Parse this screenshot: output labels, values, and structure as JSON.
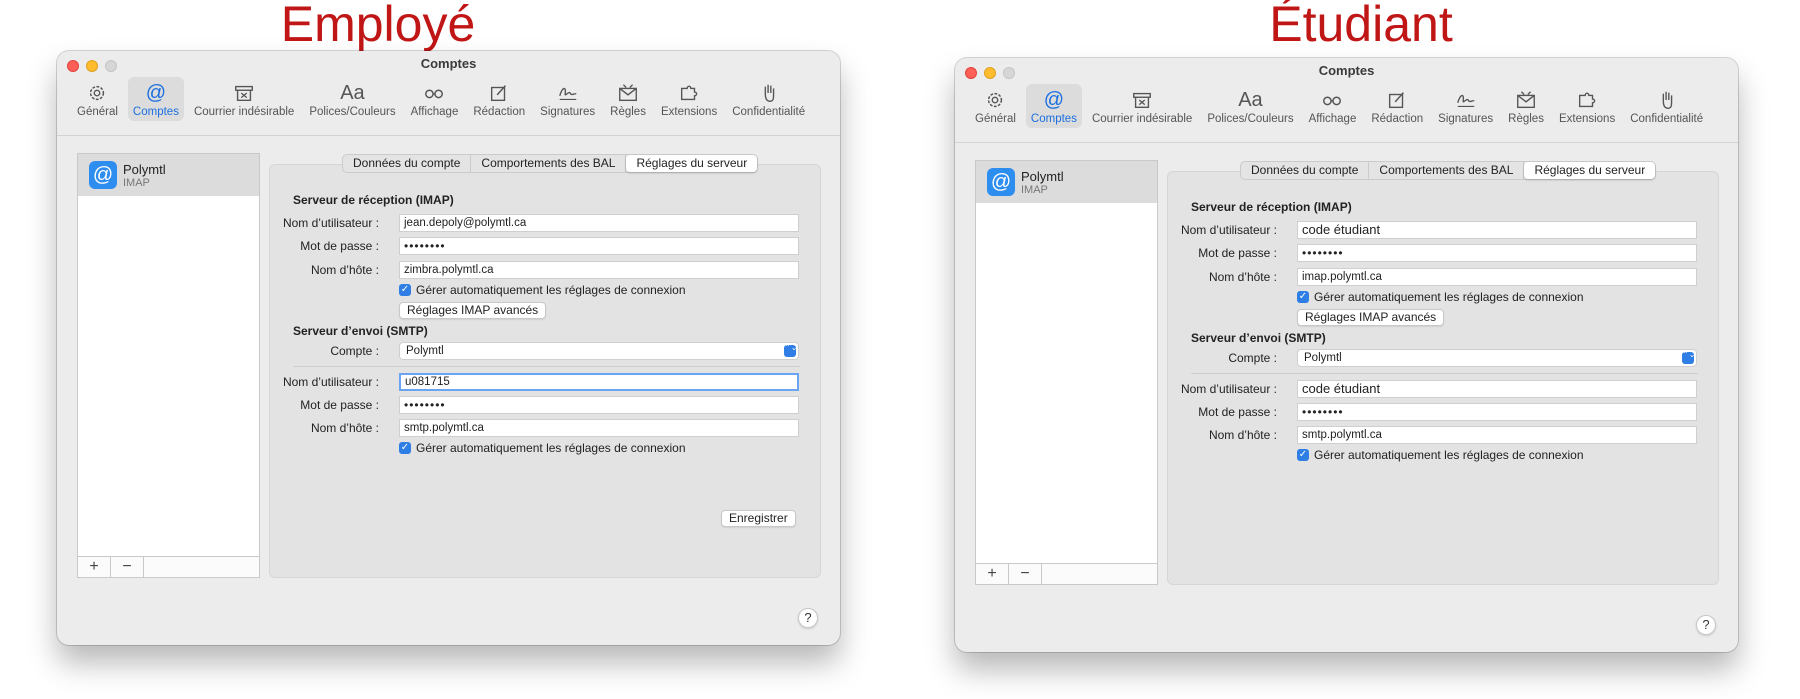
{
  "headings": {
    "left": "Employé",
    "right": "Étudiant"
  },
  "window_title": "Comptes",
  "toolbar": [
    {
      "label": "Général",
      "icon": "gear-icon"
    },
    {
      "label": "Comptes",
      "icon": "at-icon"
    },
    {
      "label": "Courrier indésirable",
      "icon": "junk-tray-icon"
    },
    {
      "label": "Polices/Couleurs",
      "icon": "font-icon",
      "glyph": "Aa"
    },
    {
      "label": "Affichage",
      "icon": "glasses-icon"
    },
    {
      "label": "Rédaction",
      "icon": "compose-icon"
    },
    {
      "label": "Signatures",
      "icon": "signature-icon"
    },
    {
      "label": "Règles",
      "icon": "rules-icon"
    },
    {
      "label": "Extensions",
      "icon": "puzzle-icon"
    },
    {
      "label": "Confidentialité",
      "icon": "hand-icon"
    }
  ],
  "account": {
    "name": "Polymtl",
    "type": "IMAP",
    "icon_glyph": "@"
  },
  "list_footer": {
    "add": "+",
    "remove": "−"
  },
  "tabs": [
    "Données du compte",
    "Comportements des BAL",
    "Réglages du serveur"
  ],
  "labels": {
    "incoming_title": "Serveur de réception (IMAP)",
    "username": "Nom d’utilisateur :",
    "password": "Mot de passe :",
    "hostname": "Nom d’hôte :",
    "auto_manage": "Gérer automatiquement les réglages de connexion",
    "advanced_imap": "Réglages IMAP avancés",
    "outgoing_title": "Serveur d’envoi (SMTP)",
    "account": "Compte :",
    "save": "Enregistrer",
    "help": "?",
    "checkmark": "✓",
    "select_arrow": "⌃⌄"
  },
  "employee": {
    "imap_user": "jean.depoly@polymtl.ca",
    "imap_password": "••••••••",
    "imap_host": "zimbra.polymtl.ca",
    "smtp_account": "Polymtl",
    "smtp_user": "u081715",
    "smtp_password": "••••••••",
    "smtp_host": "smtp.polymtl.ca"
  },
  "student": {
    "imap_user": "code étudiant",
    "imap_password": "••••••••",
    "imap_host": "imap.polymtl.ca",
    "smtp_account": "Polymtl",
    "smtp_user": "code étudiant",
    "smtp_password": "••••••••",
    "smtp_host": "smtp.polymtl.ca"
  },
  "colors": {
    "heading_red": "#c01616",
    "accent_blue": "#1b6fe0"
  }
}
